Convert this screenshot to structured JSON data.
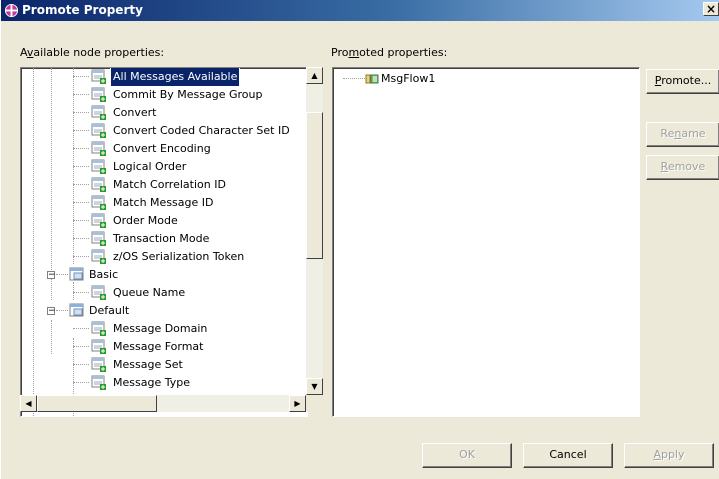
{
  "window": {
    "title": "Promote Property",
    "close_label": "×"
  },
  "labels": {
    "available_pre": "A",
    "available_ul": "v",
    "available_post": "ailable node properties:",
    "promoted_pre": "Pro",
    "promoted_ul": "m",
    "promoted_post": "oted properties:"
  },
  "left_tree": {
    "items": [
      {
        "label": "All Messages Available",
        "selected": true
      },
      {
        "label": "Commit By Message Group"
      },
      {
        "label": "Convert"
      },
      {
        "label": "Convert Coded Character Set ID"
      },
      {
        "label": "Convert Encoding"
      },
      {
        "label": "Logical Order"
      },
      {
        "label": "Match Correlation ID"
      },
      {
        "label": "Match Message ID"
      },
      {
        "label": "Order Mode"
      },
      {
        "label": "Transaction Mode"
      },
      {
        "label": "z/OS Serialization Token"
      }
    ],
    "basic": {
      "label": "Basic",
      "children": [
        "Queue Name"
      ]
    },
    "default": {
      "label": "Default",
      "children": [
        "Message Domain",
        "Message Format",
        "Message Set",
        "Message Type"
      ]
    }
  },
  "right_tree": {
    "items": [
      {
        "label": "MsgFlow1"
      }
    ]
  },
  "side_buttons": {
    "promote_ul": "P",
    "promote_post": "romote...",
    "rename_pre": "Re",
    "rename_ul": "n",
    "rename_post": "ame",
    "remove_ul": "R",
    "remove_post": "emove"
  },
  "bottom_buttons": {
    "ok": "OK",
    "cancel": "Cancel",
    "apply_ul": "A",
    "apply_post": "pply"
  },
  "colors": {
    "selection": "#0a246a",
    "dialog_bg": "#ece9d8",
    "title_bar": "#0a246a"
  }
}
